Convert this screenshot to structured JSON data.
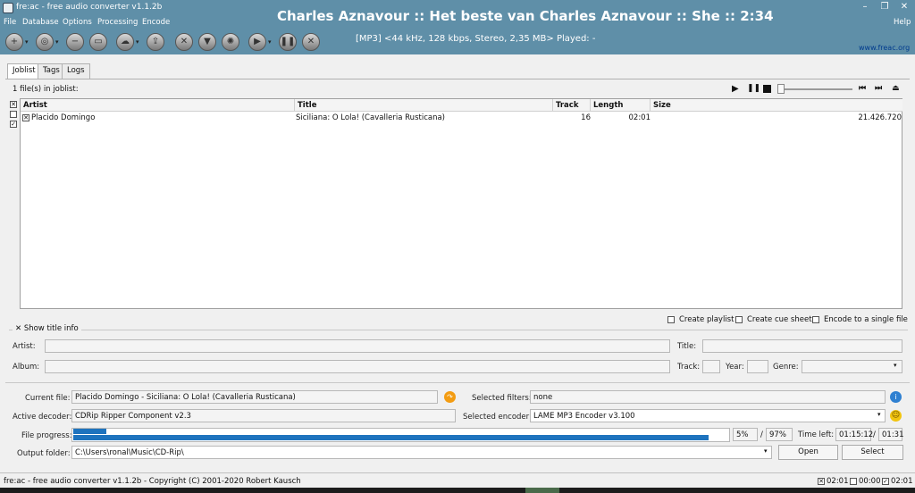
{
  "window": {
    "title": "fre:ac - free audio converter v1.1.2b",
    "now_playing": "Charles Aznavour :: Het beste van Charles Aznavour :: She :: 2:34"
  },
  "menu": {
    "file": "File",
    "database": "Database",
    "options": "Options",
    "processing": "Processing",
    "encode": "Encode",
    "help": "Help"
  },
  "toolbar": {
    "track_info": "[MP3] <44 kHz, 128 kbps, Stereo, 2,35 MB> Played: -",
    "website": "www.freac.org"
  },
  "tabs": {
    "joblist": "Joblist",
    "tags": "Tags",
    "logs": "Logs"
  },
  "joblist": {
    "count_text": "1 file(s) in joblist:",
    "columns": {
      "artist": "Artist",
      "title": "Title",
      "track": "Track",
      "length": "Length",
      "size": "Size"
    },
    "rows": [
      {
        "artist": "Placido Domingo",
        "title": "Siciliana: O Lola! (Cavalleria Rusticana)",
        "track": "16",
        "length": "02:01",
        "size": "21.426.720"
      }
    ]
  },
  "options": {
    "create_playlist": "Create playlist",
    "create_cue_sheet": "Create cue sheet",
    "encode_single": "Encode to a single file"
  },
  "title_info": {
    "toggle": "Show title info",
    "artist_label": "Artist:",
    "title_label": "Title:",
    "album_label": "Album:",
    "track_label": "Track:",
    "year_label": "Year:",
    "genre_label": "Genre:"
  },
  "status": {
    "current_file_label": "Current file:",
    "current_file": "Placido Domingo - Siciliana: O Lola! (Cavalleria Rusticana)",
    "selected_filters_label": "Selected filters:",
    "selected_filters": "none",
    "active_decoder_label": "Active decoder:",
    "active_decoder": "CDRip Ripper Component v2.3",
    "selected_encoder_label": "Selected encoder:",
    "selected_encoder": "LAME MP3 Encoder v3.100",
    "file_progress_label": "File progress:",
    "file_progress_pct": "5%",
    "total_progress_pct": "97%",
    "file_progress_value": 0.05,
    "total_progress_value": 0.97,
    "time_left_label": "Time left:",
    "time_left": "01:15:12",
    "total_time": "01:31",
    "slash1": "/",
    "slash2": "/",
    "output_folder_label": "Output folder:",
    "output_folder": "C:\\Users\\ronal\\Music\\CD-Rip\\",
    "open_button": "Open",
    "select_button": "Select"
  },
  "statusbar": {
    "text": "fre:ac - free audio converter v1.1.2b - Copyright (C) 2001-2020 Robert Kausch",
    "total_selected": "02:01",
    "total_unselected": "00:00",
    "total_checked": "02:01"
  },
  "colors": {
    "accent": "#5f8fa8",
    "progress": "#1e73be"
  }
}
